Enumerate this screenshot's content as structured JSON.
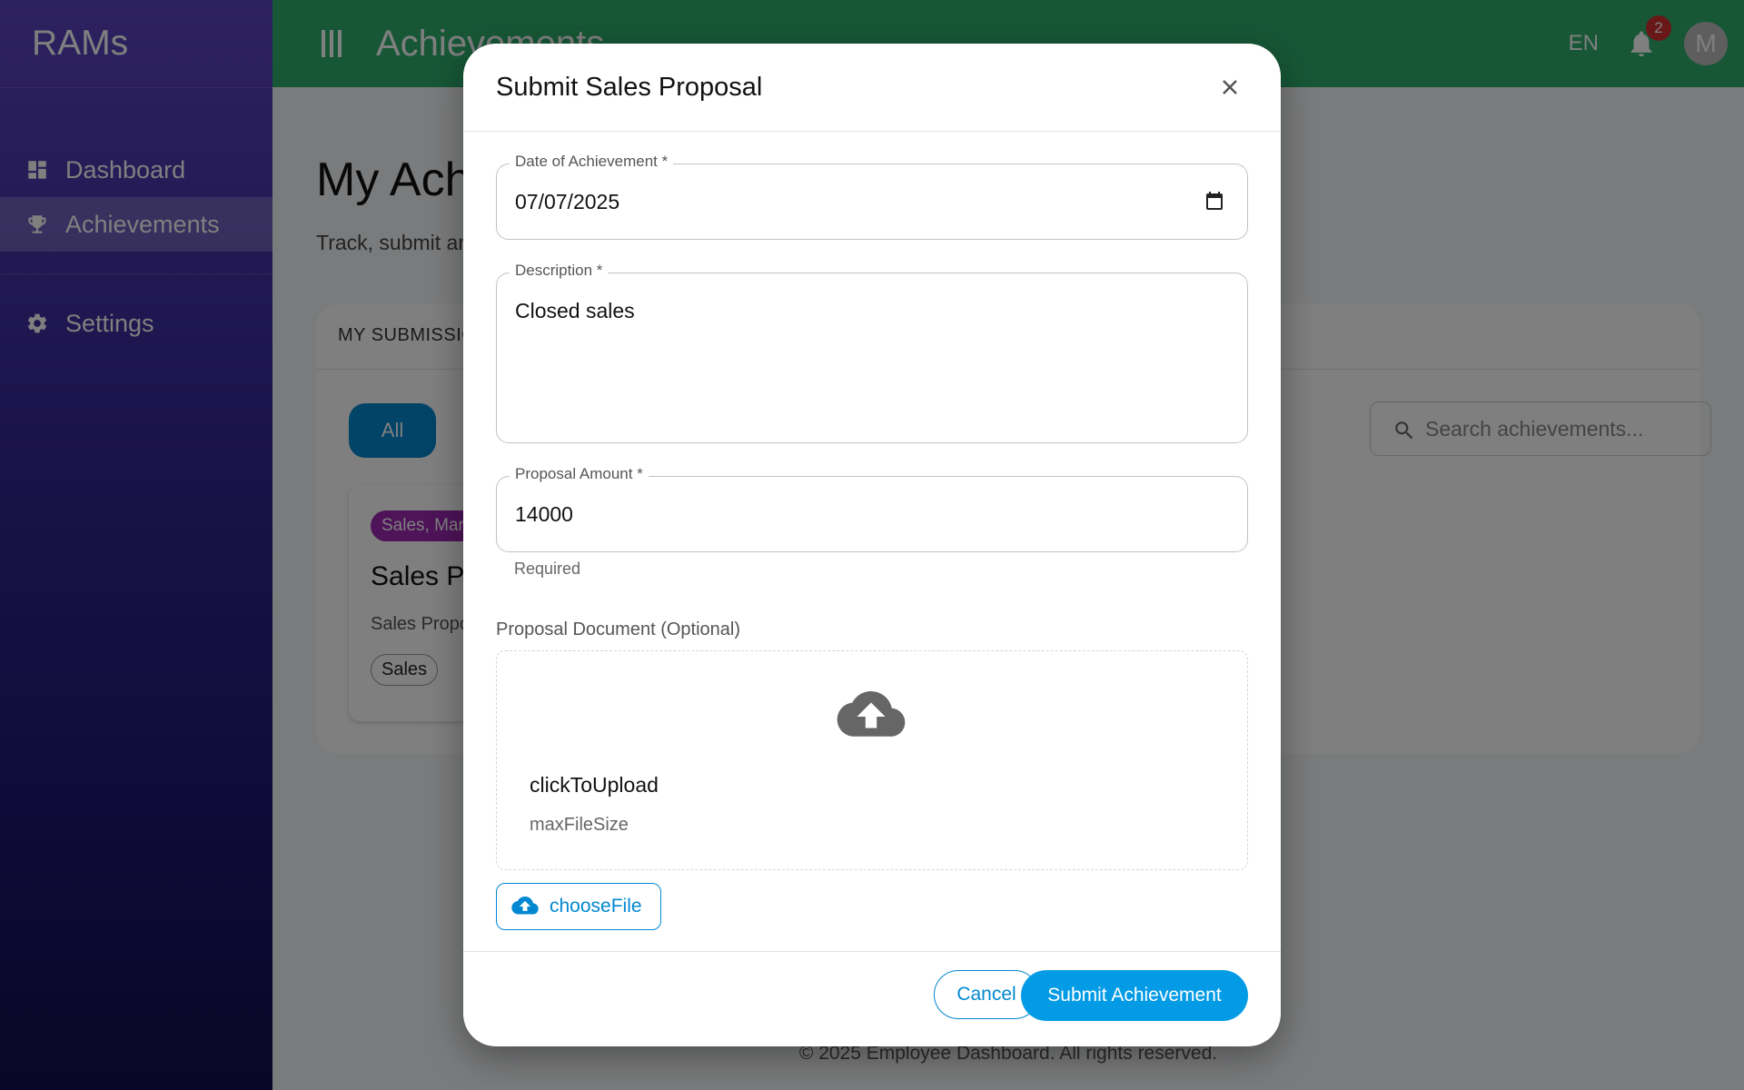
{
  "sidebar": {
    "brand": "RAMs",
    "items": [
      {
        "label": "Dashboard",
        "icon": "dashboard-icon"
      },
      {
        "label": "Achievements",
        "icon": "trophy-icon",
        "active": true
      },
      {
        "label": "Settings",
        "icon": "gear-icon"
      }
    ]
  },
  "header": {
    "title": "Achievements",
    "lang": "EN",
    "notification_count": "2",
    "avatar_initial": "M",
    "color": "#2eae6c"
  },
  "page": {
    "title": "My Achievements",
    "subtitle": "Track, submit and manage your achievements",
    "tab": "MY SUBMISSIONS",
    "filter_all": "All",
    "search_placeholder": "Search achievements...",
    "card": {
      "tag": "Sales, Marketing",
      "title": "Sales Proposal",
      "desc": "Sales Proposal",
      "chip": "Sales"
    },
    "footer": "© 2025 Employee Dashboard. All rights reserved."
  },
  "modal": {
    "title": "Submit Sales Proposal",
    "date_label": "Date of Achievement *",
    "date_value": "07/07/2025",
    "description_label": "Description *",
    "description_value": "Closed sales",
    "amount_label": "Proposal Amount *",
    "amount_value": "14000",
    "amount_helper": "Required",
    "document_label": "Proposal Document (Optional)",
    "upload_title": "clickToUpload",
    "upload_sub": "maxFileSize",
    "choose_file": "chooseFile",
    "cancel": "Cancel",
    "submit": "Submit Achievement",
    "accent": "#0288d1"
  }
}
